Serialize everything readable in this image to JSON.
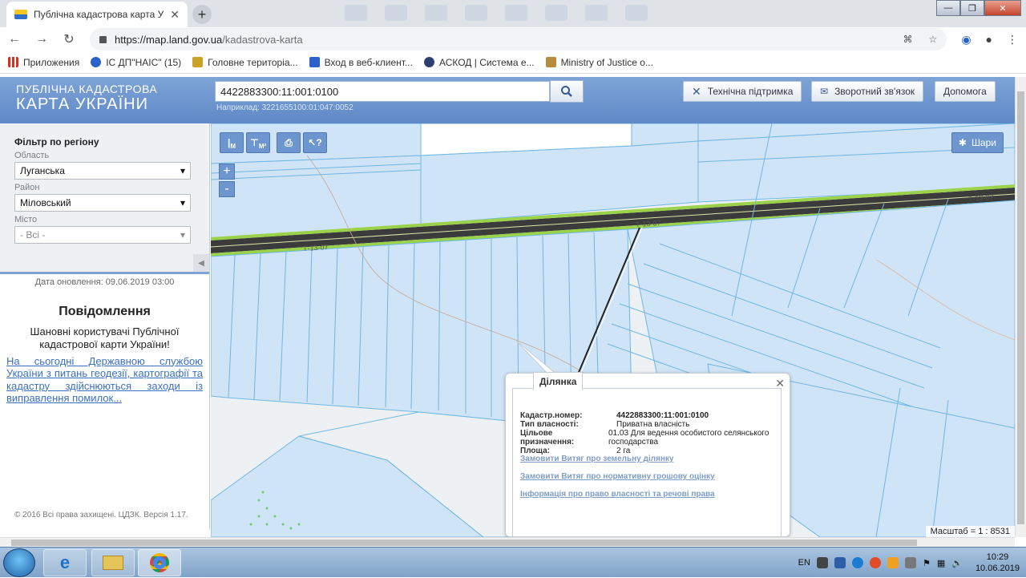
{
  "browser": {
    "tab_title": "Публічна кадастрова карта Укр",
    "url_host": "https://map.land.gov.ua",
    "url_path": "/kadastrova-karta",
    "bookmarks": [
      {
        "label": "Приложения",
        "color": "#d93025"
      },
      {
        "label": "ІС ДП\"НАІС\" (15)",
        "color": "#2a62c9"
      },
      {
        "label": "Головне територіа...",
        "color": "#c9a227"
      },
      {
        "label": "Вход в веб-клиент...",
        "color": "#2a62c9"
      },
      {
        "label": "АСКОД | Система е...",
        "color": "#2d3e73"
      },
      {
        "label": "Ministry of Justice o...",
        "color": "#b88a3a"
      }
    ]
  },
  "site": {
    "logo_line1": "ПУБЛІЧНА КАДАСТРОВА",
    "logo_line2": "КАРТА УКРАЇНИ",
    "search_value": "4422883300:11:001:0100",
    "search_hint": "Наприклад: 3221655100:01:047:0052",
    "support_label": "Технічна підтримка",
    "feedback_label": "Зворотний зв'язок",
    "help_label": "Допомога"
  },
  "filter": {
    "title": "Фільтр по регіону",
    "oblast_label": "Область",
    "oblast_value": "Луганська",
    "rayon_label": "Район",
    "rayon_value": "Міловський",
    "city_label": "Місто",
    "city_value": "- Всі -",
    "update_date": "Дата оновлення: 09.06.2019 03:00"
  },
  "notice": {
    "title": "Повідомлення",
    "text": "Шановні користувачі Публічної кадастрової карти України!",
    "link": "На сьогодні Державною службою України з питань геодезії, картографії та кадастру здійснюються заходи із виправлення помилок..."
  },
  "footer": {
    "copyright": "© 2016 Всі права захищені. ЦДЗК. Версія 1.17."
  },
  "map": {
    "layers_label": "Шари",
    "road_label": "Т-13-07",
    "scale": "Масштаб = 1 : 8531",
    "tool_labels": [
      "M",
      "M²"
    ]
  },
  "popup": {
    "tab": "Ділянка",
    "cad_key": "Кадастр.номер:",
    "cad_val": "4422883300:11:001:0100",
    "own_key": "Тип власності:",
    "own_val": "Приватна власність",
    "use_key": "Цільове призначення:",
    "use_val": "01.03 Для ведення особистого селянського господарства",
    "area_key": "Площа:",
    "area_val": "2 га",
    "link1": "Замовити Витяг про земельну ділянку",
    "link2": "Замовити Витяг про нормативну грошову оцінку",
    "link3": "Інформація про право власності та речові права"
  },
  "taskbar": {
    "lang": "EN",
    "time": "10:29",
    "date": "10.06.2019"
  },
  "colors": {
    "parcel_fill": "#cfe4f6",
    "parcel_stroke": "#6fb7e6",
    "road_green": "#9bd24a",
    "header_blue": "#6f96cf"
  }
}
